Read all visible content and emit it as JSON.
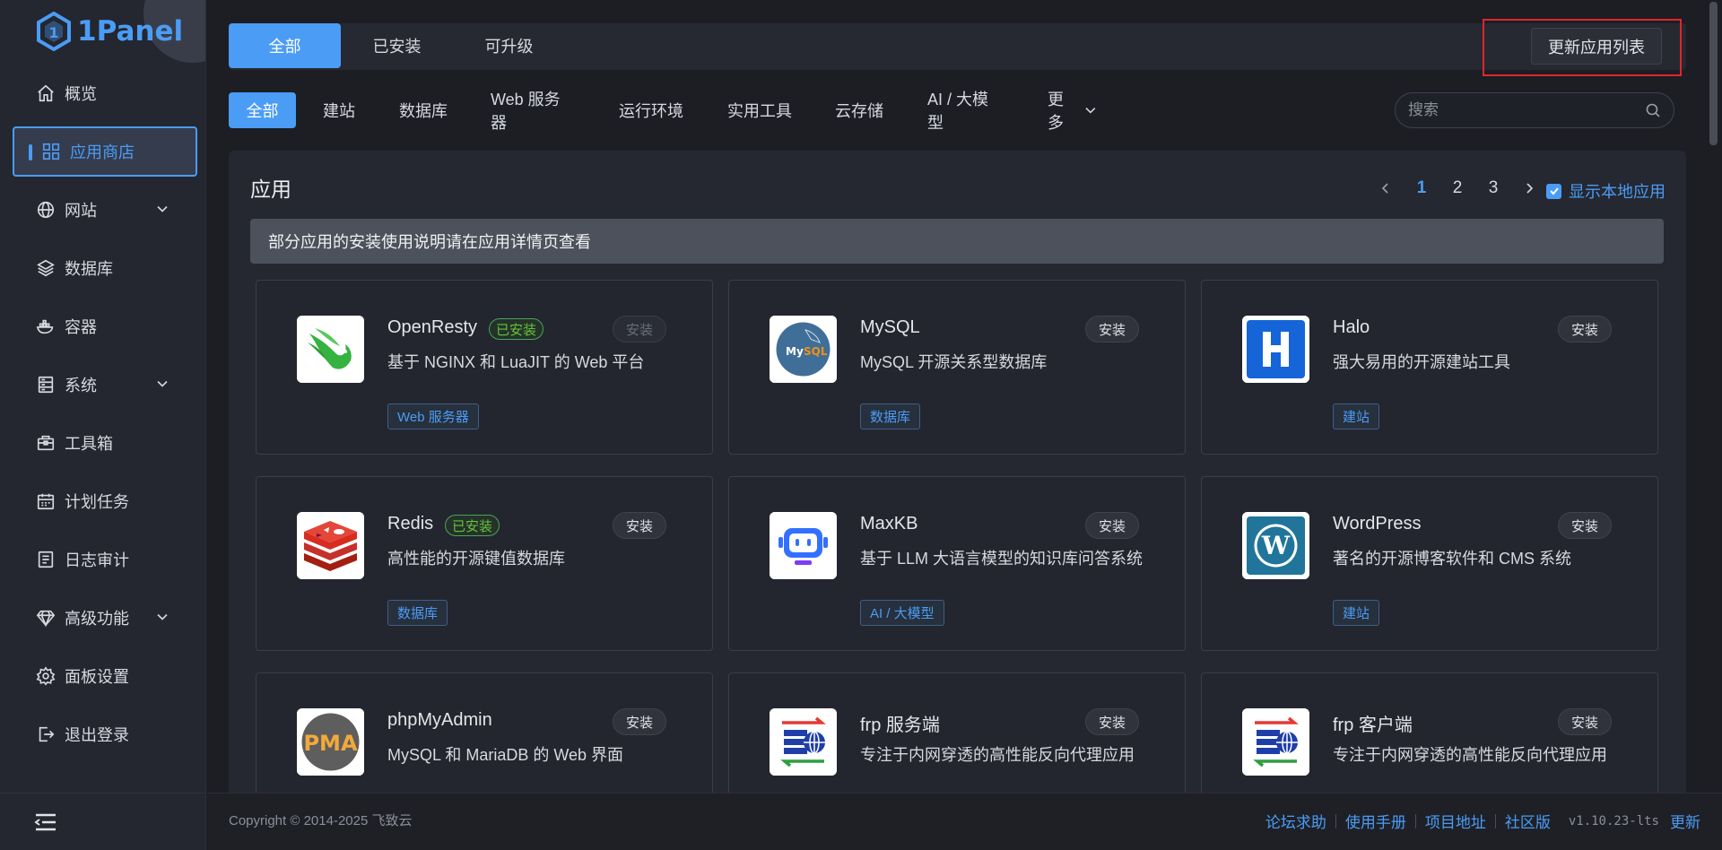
{
  "brand": {
    "name": "1Panel",
    "accent": "#4b9cf5"
  },
  "sidebar": {
    "items": [
      {
        "label": "概览",
        "icon": "home-icon"
      },
      {
        "label": "应用商店",
        "icon": "grid-icon",
        "active": true
      },
      {
        "label": "网站",
        "icon": "globe-icon",
        "expandable": true
      },
      {
        "label": "数据库",
        "icon": "layers-icon"
      },
      {
        "label": "容器",
        "icon": "container-icon"
      },
      {
        "label": "系统",
        "icon": "server-icon",
        "expandable": true
      },
      {
        "label": "工具箱",
        "icon": "toolbox-icon"
      },
      {
        "label": "计划任务",
        "icon": "calendar-icon"
      },
      {
        "label": "日志审计",
        "icon": "log-icon"
      },
      {
        "label": "高级功能",
        "icon": "diamond-icon",
        "expandable": true
      },
      {
        "label": "面板设置",
        "icon": "gear-icon"
      },
      {
        "label": "退出登录",
        "icon": "logout-icon"
      }
    ]
  },
  "top_tabs": [
    {
      "label": "全部",
      "active": true
    },
    {
      "label": "已安装"
    },
    {
      "label": "可升级"
    }
  ],
  "update_button": "更新应用列表",
  "categories": [
    {
      "label": "全部",
      "active": true
    },
    {
      "label": "建站"
    },
    {
      "label": "数据库"
    },
    {
      "label": "Web 服务器"
    },
    {
      "label": "运行环境"
    },
    {
      "label": "实用工具"
    },
    {
      "label": "云存储"
    },
    {
      "label": "AI / 大模型"
    },
    {
      "label": "更多"
    }
  ],
  "search": {
    "placeholder": "搜索",
    "value": ""
  },
  "panel": {
    "title": "应用",
    "pagination": {
      "pages": [
        "1",
        "2",
        "3"
      ],
      "current": "1"
    },
    "show_local_label": "显示本地应用",
    "show_local_checked": true,
    "notice": "部分应用的安装使用说明请在应用详情页查看"
  },
  "apps": [
    {
      "name": "OpenResty",
      "installed_label": "已安装",
      "install_label": "安装",
      "install_disabled": true,
      "desc": "基于 NGINX 和 LuaJIT 的 Web 平台",
      "tag": "Web 服务器",
      "icon": "openresty-icon"
    },
    {
      "name": "MySQL",
      "install_label": "安装",
      "desc": "MySQL 开源关系型数据库",
      "tag": "数据库",
      "icon": "mysql-icon"
    },
    {
      "name": "Halo",
      "install_label": "安装",
      "desc": "强大易用的开源建站工具",
      "tag": "建站",
      "icon": "halo-icon"
    },
    {
      "name": "Redis",
      "installed_label": "已安装",
      "install_label": "安装",
      "desc": "高性能的开源键值数据库",
      "tag": "数据库",
      "icon": "redis-icon"
    },
    {
      "name": "MaxKB",
      "install_label": "安装",
      "desc": "基于 LLM 大语言模型的知识库问答系统",
      "tag": "AI / 大模型",
      "icon": "maxkb-icon"
    },
    {
      "name": "WordPress",
      "install_label": "安装",
      "desc": "著名的开源博客软件和 CMS 系统",
      "tag": "建站",
      "icon": "wordpress-icon"
    },
    {
      "name": "phpMyAdmin",
      "install_label": "安装",
      "desc": "MySQL 和 MariaDB 的 Web 界面",
      "tag": "",
      "icon": "phpmyadmin-icon"
    },
    {
      "name": "frp 服务端",
      "install_label": "安装",
      "desc": "专注于内网穿透的高性能反向代理应用",
      "tag": "",
      "icon": "frp-icon"
    },
    {
      "name": "frp 客户端",
      "install_label": "安装",
      "desc": "专注于内网穿透的高性能反向代理应用",
      "tag": "",
      "icon": "frp-icon"
    }
  ],
  "footer": {
    "copyright": "Copyright © 2014-2025 飞致云",
    "links": [
      "论坛求助",
      "使用手册",
      "项目地址",
      "社区版"
    ],
    "version": "v1.10.23-lts",
    "update": "更新"
  }
}
